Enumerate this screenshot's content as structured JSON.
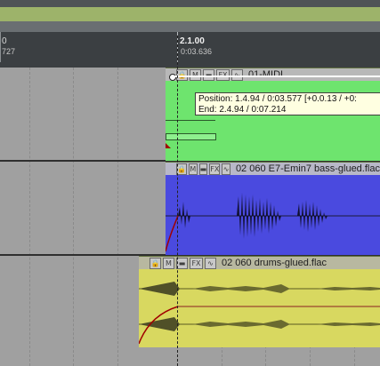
{
  "ruler": {
    "left_label": "0",
    "left_time": "727",
    "marker_label": "2.1.00",
    "marker_time": "0:03.636"
  },
  "tracks": {
    "midi": {
      "title": "01-MIDI",
      "color": "#66e266"
    },
    "bass": {
      "title": "02 060 E7-Emin7 bass-glued.flac",
      "color": "#4a4adf"
    },
    "drums": {
      "title": "02 060 drums-glued.flac",
      "color": "#d8d860"
    }
  },
  "item_buttons": [
    "lock-icon",
    "midi-icon",
    "comment-icon",
    "FX",
    "envelope-icon"
  ],
  "tooltip": {
    "position": "Position: 1.4.94 / 0:03.577 [+0.0.13 / +0:",
    "end": "End: 2.4.94 / 0:07.214"
  },
  "colors": {
    "topbar": "#4f5356",
    "greenbar": "#9db36a",
    "ruler_bg": "#3b3f42",
    "lane_bg": "#a0a0a0"
  }
}
